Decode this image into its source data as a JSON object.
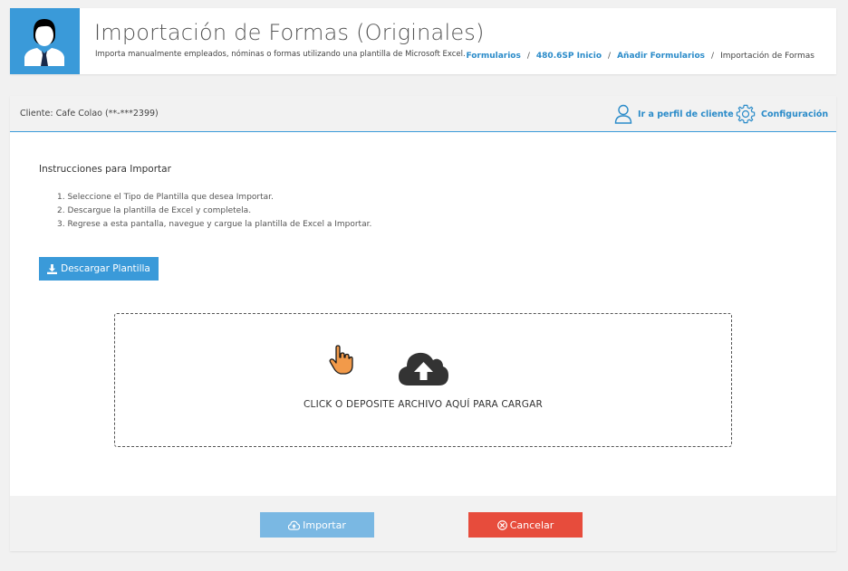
{
  "header": {
    "title": "Importación de Formas (Originales)",
    "subtitle": "Importa manualmente empleados, nóminas o formas utilizando una plantilla de Microsoft Excel.",
    "breadcrumb": [
      {
        "label": "Formularios",
        "link": true
      },
      {
        "label": "480.6SP Inicio",
        "link": true
      },
      {
        "label": "Añadir Formularios",
        "link": true
      },
      {
        "label": "Importación de Formas",
        "link": false
      }
    ]
  },
  "panel": {
    "client_label": "Cliente: Cafe Colao (**-***2399)",
    "profile_link": "Ir a perfil de cliente",
    "config_link": "Configuración"
  },
  "instructions": {
    "title": "Instrucciones para Importar",
    "steps": [
      "1. Seleccione el Tipo de Plantilla que desea Importar.",
      "2. Descargue la plantilla de Excel y completela.",
      "3. Regrese a esta pantalla, navegue y cargue la plantilla de Excel a Importar."
    ]
  },
  "download_button": "Descargar Plantilla",
  "dropzone": {
    "text": "CLICK O DEPOSITE ARCHIVO AQUÍ PARA CARGAR",
    "icon": "cloud-upload-icon"
  },
  "footer": {
    "import_label": "Importar",
    "cancel_label": "Cancelar"
  },
  "colors": {
    "primary": "#3a9ad9",
    "import_disabled": "#7ab8e3",
    "danger": "#e74c3c",
    "link": "#2a8bc9"
  }
}
